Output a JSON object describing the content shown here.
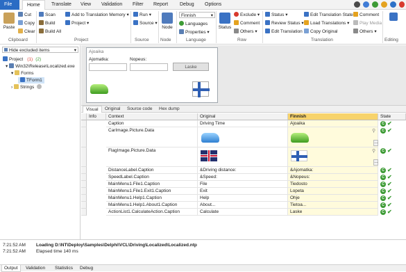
{
  "menubar": {
    "tabs": [
      "File",
      "Home",
      "Translate",
      "View",
      "Validation",
      "Filter",
      "Report",
      "Debug",
      "Options"
    ],
    "active": "Home"
  },
  "ribbon": {
    "clipboard": {
      "paste": "Paste",
      "cut": "Cut",
      "copy": "Copy",
      "clear": "Clear",
      "group": "Clipboard"
    },
    "project": {
      "scan": "Scan",
      "build": "Build",
      "build_all": "Build All",
      "add_tm": "Add to Translation Memory",
      "project": "Project",
      "group": "Project"
    },
    "source": {
      "run": "Run",
      "source": "Source",
      "group": "Source"
    },
    "node": {
      "node": "Node",
      "group": "Node"
    },
    "language": {
      "selected": "Finnish",
      "languages": "Languages",
      "properties": "Properties",
      "group": "Language"
    },
    "row": {
      "status": "Status",
      "exclude": "Exclude",
      "comment": "Comment",
      "others": "Others",
      "group": "Row"
    },
    "translation": {
      "status": "Status",
      "review_status": "Review Status",
      "edit_translation": "Edit Translation",
      "edit_state": "Edit Translation State",
      "load_translations": "Load Translations",
      "copy_original": "Copy Original",
      "comment": "Comment",
      "play_media": "Play Media",
      "others": "Others",
      "group": "Translation"
    },
    "editing": {
      "group": "Editing"
    }
  },
  "tree": {
    "filter": "Hide excluded items",
    "project": "Project",
    "project_counts": [
      "(1)",
      "(2)"
    ],
    "exe": "Win32\\Release\\Localized.exe",
    "forms": "Forms",
    "form1": "TForm1",
    "strings": "Strings"
  },
  "designer": {
    "form_title": "Ajoaika",
    "distance_label": "Ajomatka:",
    "speed_label": "Nopeus:",
    "button": "Laske"
  },
  "view_tabs": [
    "Visual",
    "Original",
    "Source code",
    "Hex dump"
  ],
  "grid": {
    "headers": {
      "info": "Info",
      "context": "Context",
      "original": "Original",
      "finnish": "Finnish",
      "state": "State"
    },
    "rows": [
      {
        "context": "Caption",
        "original": "Driving Time",
        "finnish": "Ajoaika"
      },
      {
        "context": "CarImage.Picture.Data",
        "original": "",
        "finnish": ""
      },
      {
        "context": "FlagImage.Picture.Data",
        "original": "",
        "finnish": ""
      },
      {
        "context": "DistanceLabel.Caption",
        "original": "&Driving distance:",
        "finnish": "&Ajomatka:"
      },
      {
        "context": "SpeedLabel.Caption",
        "original": "&Speed:",
        "finnish": "&Nopeus:"
      },
      {
        "context": "MainMenu1.File1.Caption",
        "original": "File",
        "finnish": "Tiedosto"
      },
      {
        "context": "MainMenu1.File1.Exit1.Caption",
        "original": "Exit",
        "finnish": "Lopeta"
      },
      {
        "context": "MainMenu1.Help1.Caption",
        "original": "Help",
        "finnish": "Ohje"
      },
      {
        "context": "MainMenu1.Help1.About1.Caption",
        "original": "About...",
        "finnish": "Tietoa..."
      },
      {
        "context": "ActionList1.CalculateAction.Caption",
        "original": "Calculate",
        "finnish": "Laske"
      }
    ]
  },
  "output": {
    "lines": [
      {
        "time": "7:21:52 AM",
        "text": "Loading D:\\NT\\Deploy\\Samples\\Delphi\\VCL\\Driving\\Localized\\Localized.ntp"
      },
      {
        "time": "7:21:52 AM",
        "text": "Elapsed time 140 ms"
      }
    ]
  },
  "bottom_tabs": [
    "Output",
    "Validation",
    "Statistics",
    "Debug"
  ]
}
